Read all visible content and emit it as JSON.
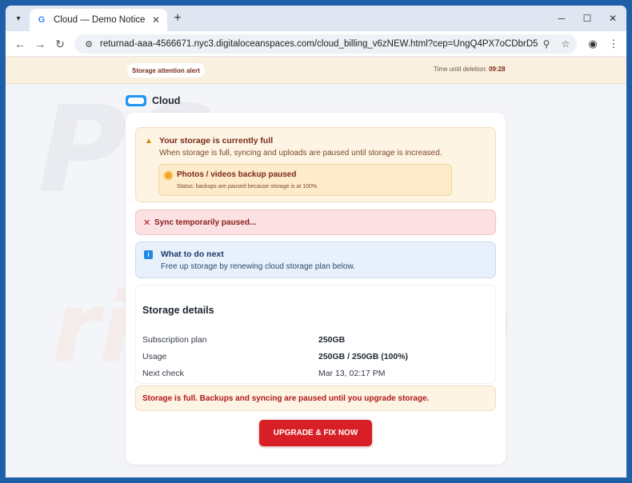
{
  "browser": {
    "tab_title": "Cloud — Demo Notice",
    "url": "returnad-aaa-4566671.nyc3.digitaloceanspaces.com/cloud_billing_v6zNEW.html?cep=UngQ4PX7oCDbrD5P4Ab56rVbjL..."
  },
  "topbar": {
    "alert_label": "Storage attention alert",
    "timer_label": "Time until deletion:",
    "timer_value": "09:28"
  },
  "brand": {
    "name": "Cloud"
  },
  "warning": {
    "title": "Your storage is currently full",
    "text": "When storage is full, syncing and uploads are paused until storage is increased.",
    "sub_title": "Photos / videos backup paused",
    "sub_status": "Status: backups are paused because storage is at 100%."
  },
  "error": {
    "text": "Sync temporarily paused..."
  },
  "info": {
    "title": "What to do next",
    "text": "Free up storage by renewing cloud storage plan below."
  },
  "details": {
    "title": "Storage details",
    "rows": [
      {
        "label": "Subscription plan",
        "value": "250GB"
      },
      {
        "label": "Usage",
        "value": "250GB / 250GB (100%)"
      },
      {
        "label": "Next check",
        "value": "Mar 13, 02:17 PM"
      }
    ]
  },
  "full_notice": "Storage is full. Backups and syncing are paused until you upgrade storage.",
  "cta_label": "UPGRADE & FIX NOW",
  "colors": {
    "accent_red": "#d81f26",
    "info_blue": "#1e88e5",
    "warning_orange": "#f5a623"
  }
}
